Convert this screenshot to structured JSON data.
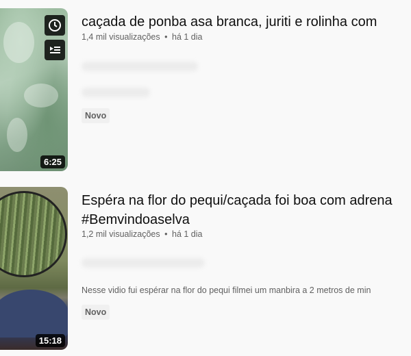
{
  "videos": [
    {
      "title": "caçada de ponba asa branca, juriti e rolinha com",
      "views": "1,4 mil visualizações",
      "time": "há 1 dia",
      "duration": "6:25",
      "badge": "Novo",
      "overlay_icons": [
        "clock-icon",
        "queue-icon"
      ]
    },
    {
      "title": "Espéra na flor do pequi/caçada foi boa com adrena #Bemvindoaselva",
      "views": "1,2 mil visualizações",
      "time": "há 1 dia",
      "description": "Nesse vidio fui espérar na flor do pequi filmei um manbira a 2 metros de min",
      "duration": "15:18",
      "badge": "Novo"
    }
  ],
  "separator": "•"
}
